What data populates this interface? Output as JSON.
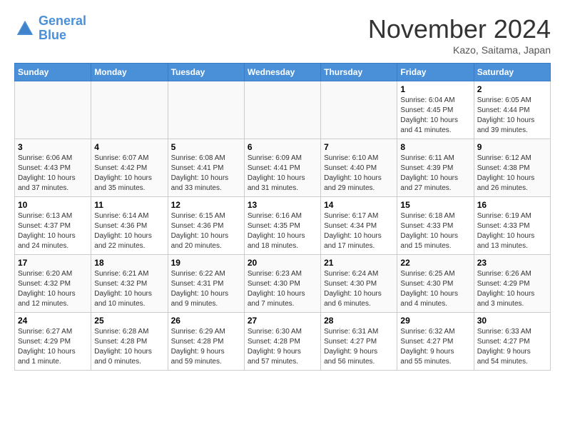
{
  "logo": {
    "line1": "General",
    "line2": "Blue"
  },
  "title": "November 2024",
  "subtitle": "Kazo, Saitama, Japan",
  "days_of_week": [
    "Sunday",
    "Monday",
    "Tuesday",
    "Wednesday",
    "Thursday",
    "Friday",
    "Saturday"
  ],
  "weeks": [
    [
      {
        "day": "",
        "info": ""
      },
      {
        "day": "",
        "info": ""
      },
      {
        "day": "",
        "info": ""
      },
      {
        "day": "",
        "info": ""
      },
      {
        "day": "",
        "info": ""
      },
      {
        "day": "1",
        "info": "Sunrise: 6:04 AM\nSunset: 4:45 PM\nDaylight: 10 hours\nand 41 minutes."
      },
      {
        "day": "2",
        "info": "Sunrise: 6:05 AM\nSunset: 4:44 PM\nDaylight: 10 hours\nand 39 minutes."
      }
    ],
    [
      {
        "day": "3",
        "info": "Sunrise: 6:06 AM\nSunset: 4:43 PM\nDaylight: 10 hours\nand 37 minutes."
      },
      {
        "day": "4",
        "info": "Sunrise: 6:07 AM\nSunset: 4:42 PM\nDaylight: 10 hours\nand 35 minutes."
      },
      {
        "day": "5",
        "info": "Sunrise: 6:08 AM\nSunset: 4:41 PM\nDaylight: 10 hours\nand 33 minutes."
      },
      {
        "day": "6",
        "info": "Sunrise: 6:09 AM\nSunset: 4:41 PM\nDaylight: 10 hours\nand 31 minutes."
      },
      {
        "day": "7",
        "info": "Sunrise: 6:10 AM\nSunset: 4:40 PM\nDaylight: 10 hours\nand 29 minutes."
      },
      {
        "day": "8",
        "info": "Sunrise: 6:11 AM\nSunset: 4:39 PM\nDaylight: 10 hours\nand 27 minutes."
      },
      {
        "day": "9",
        "info": "Sunrise: 6:12 AM\nSunset: 4:38 PM\nDaylight: 10 hours\nand 26 minutes."
      }
    ],
    [
      {
        "day": "10",
        "info": "Sunrise: 6:13 AM\nSunset: 4:37 PM\nDaylight: 10 hours\nand 24 minutes."
      },
      {
        "day": "11",
        "info": "Sunrise: 6:14 AM\nSunset: 4:36 PM\nDaylight: 10 hours\nand 22 minutes."
      },
      {
        "day": "12",
        "info": "Sunrise: 6:15 AM\nSunset: 4:36 PM\nDaylight: 10 hours\nand 20 minutes."
      },
      {
        "day": "13",
        "info": "Sunrise: 6:16 AM\nSunset: 4:35 PM\nDaylight: 10 hours\nand 18 minutes."
      },
      {
        "day": "14",
        "info": "Sunrise: 6:17 AM\nSunset: 4:34 PM\nDaylight: 10 hours\nand 17 minutes."
      },
      {
        "day": "15",
        "info": "Sunrise: 6:18 AM\nSunset: 4:33 PM\nDaylight: 10 hours\nand 15 minutes."
      },
      {
        "day": "16",
        "info": "Sunrise: 6:19 AM\nSunset: 4:33 PM\nDaylight: 10 hours\nand 13 minutes."
      }
    ],
    [
      {
        "day": "17",
        "info": "Sunrise: 6:20 AM\nSunset: 4:32 PM\nDaylight: 10 hours\nand 12 minutes."
      },
      {
        "day": "18",
        "info": "Sunrise: 6:21 AM\nSunset: 4:32 PM\nDaylight: 10 hours\nand 10 minutes."
      },
      {
        "day": "19",
        "info": "Sunrise: 6:22 AM\nSunset: 4:31 PM\nDaylight: 10 hours\nand 9 minutes."
      },
      {
        "day": "20",
        "info": "Sunrise: 6:23 AM\nSunset: 4:30 PM\nDaylight: 10 hours\nand 7 minutes."
      },
      {
        "day": "21",
        "info": "Sunrise: 6:24 AM\nSunset: 4:30 PM\nDaylight: 10 hours\nand 6 minutes."
      },
      {
        "day": "22",
        "info": "Sunrise: 6:25 AM\nSunset: 4:30 PM\nDaylight: 10 hours\nand 4 minutes."
      },
      {
        "day": "23",
        "info": "Sunrise: 6:26 AM\nSunset: 4:29 PM\nDaylight: 10 hours\nand 3 minutes."
      }
    ],
    [
      {
        "day": "24",
        "info": "Sunrise: 6:27 AM\nSunset: 4:29 PM\nDaylight: 10 hours\nand 1 minute."
      },
      {
        "day": "25",
        "info": "Sunrise: 6:28 AM\nSunset: 4:28 PM\nDaylight: 10 hours\nand 0 minutes."
      },
      {
        "day": "26",
        "info": "Sunrise: 6:29 AM\nSunset: 4:28 PM\nDaylight: 9 hours\nand 59 minutes."
      },
      {
        "day": "27",
        "info": "Sunrise: 6:30 AM\nSunset: 4:28 PM\nDaylight: 9 hours\nand 57 minutes."
      },
      {
        "day": "28",
        "info": "Sunrise: 6:31 AM\nSunset: 4:27 PM\nDaylight: 9 hours\nand 56 minutes."
      },
      {
        "day": "29",
        "info": "Sunrise: 6:32 AM\nSunset: 4:27 PM\nDaylight: 9 hours\nand 55 minutes."
      },
      {
        "day": "30",
        "info": "Sunrise: 6:33 AM\nSunset: 4:27 PM\nDaylight: 9 hours\nand 54 minutes."
      }
    ]
  ]
}
